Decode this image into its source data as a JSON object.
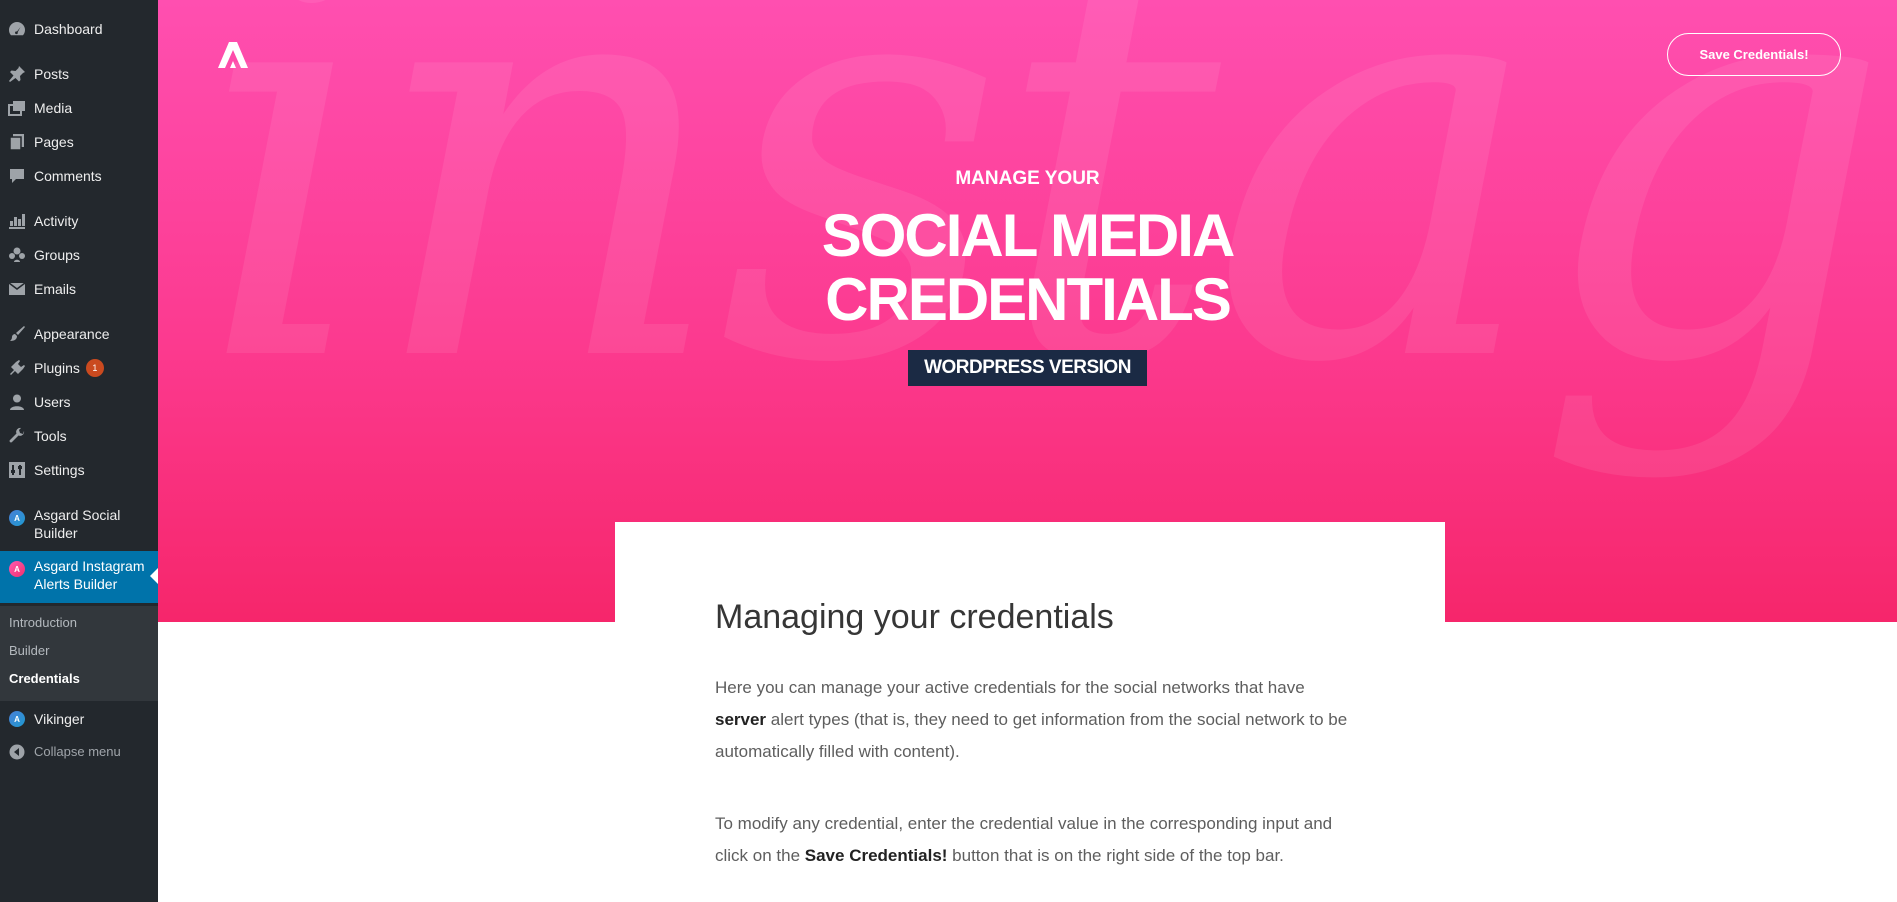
{
  "sidebar": {
    "items": [
      {
        "label": "Dashboard"
      },
      {
        "label": "Posts"
      },
      {
        "label": "Media"
      },
      {
        "label": "Pages"
      },
      {
        "label": "Comments"
      },
      {
        "label": "Activity"
      },
      {
        "label": "Groups"
      },
      {
        "label": "Emails"
      },
      {
        "label": "Appearance"
      },
      {
        "label": "Plugins",
        "badge": "1"
      },
      {
        "label": "Users"
      },
      {
        "label": "Tools"
      },
      {
        "label": "Settings"
      },
      {
        "label": "Asgard Social Builder"
      },
      {
        "label": "Asgard Instagram Alerts Builder"
      },
      {
        "label": "Vikinger"
      },
      {
        "label": "Collapse menu"
      }
    ],
    "submenu": [
      {
        "label": "Introduction"
      },
      {
        "label": "Builder"
      },
      {
        "label": "Credentials"
      }
    ]
  },
  "hero": {
    "watermark": "instagram",
    "save_button": "Save Credentials!",
    "eyebrow": "MANAGE YOUR",
    "title_line1": "SOCIAL MEDIA",
    "title_line2": "CREDENTIALS",
    "tag": "WORDPRESS VERSION"
  },
  "content": {
    "heading": "Managing your credentials",
    "para1_a": "Here you can manage your active credentials for the social networks that have ",
    "para1_bold": "server",
    "para1_b": " alert types (that is, they need to get information from the social network to be automatically filled with content).",
    "para2_a": "To modify any credential, enter the credential value in the corresponding input and click on the ",
    "para2_bold": "Save Credentials!",
    "para2_b": " button that is on the right side of the top bar."
  },
  "colors": {
    "sidebar_bg": "#23282d",
    "active_menu": "#0073aa",
    "hero_pink": "#fc3a8f",
    "tag_bg": "#1b2a44"
  }
}
